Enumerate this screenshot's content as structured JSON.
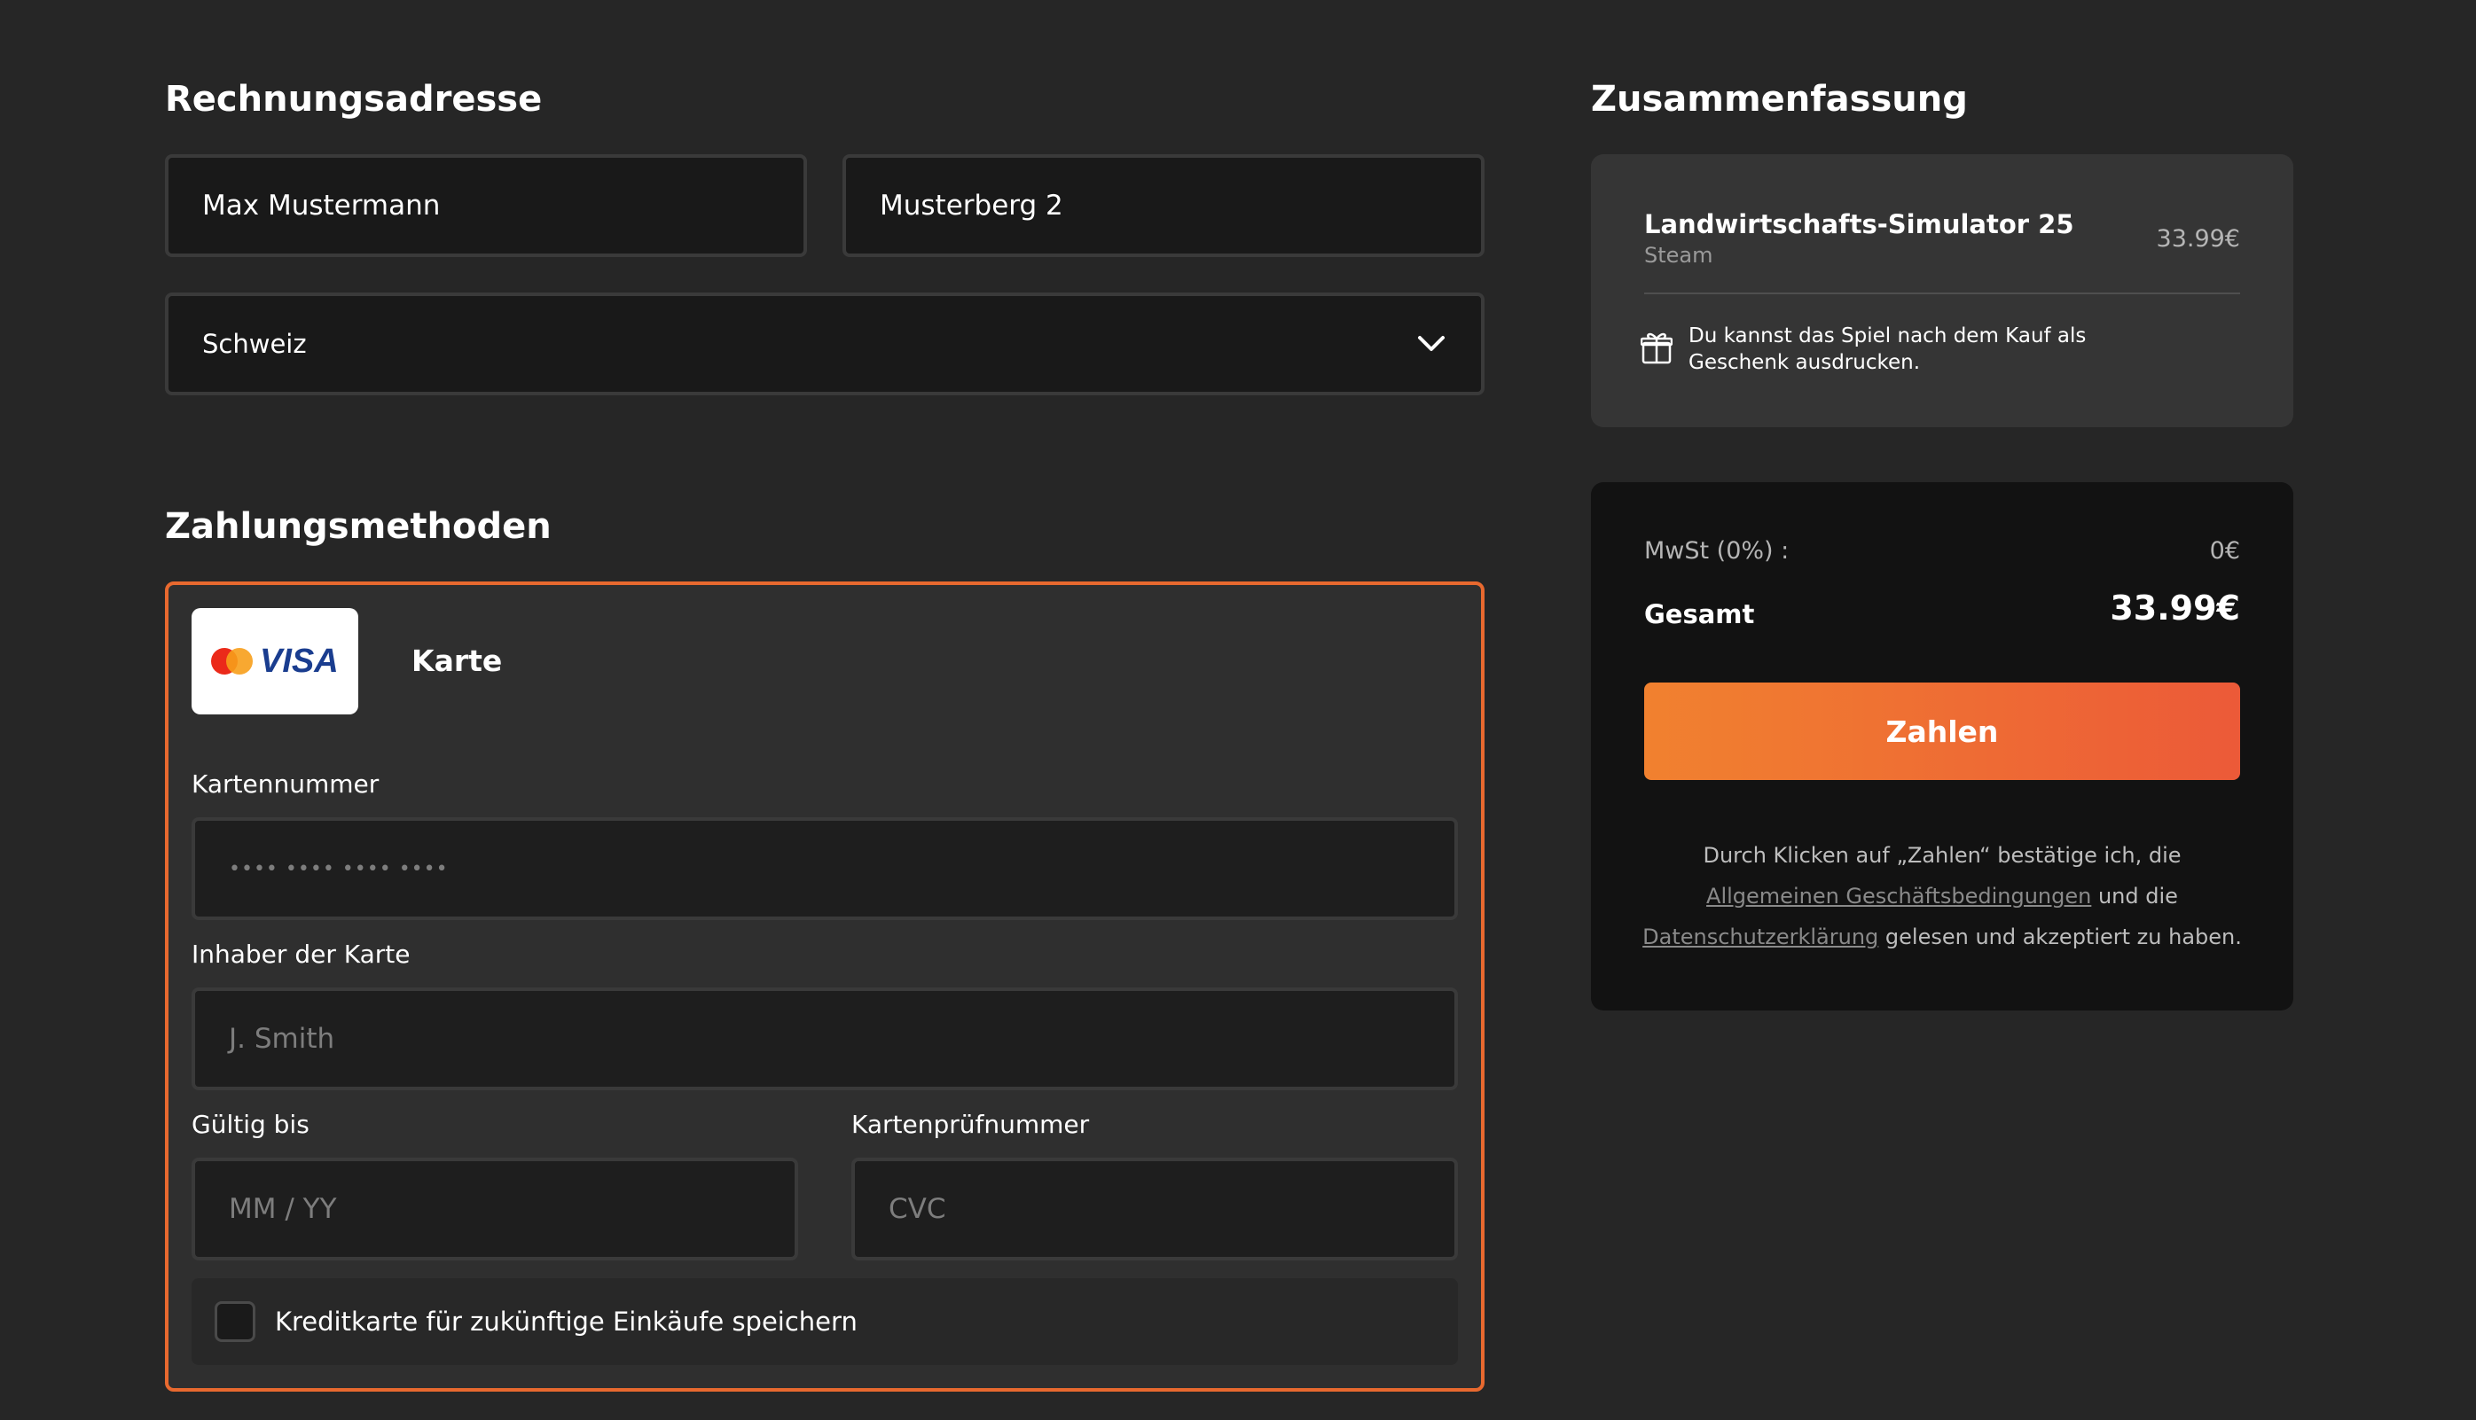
{
  "billing": {
    "title": "Rechnungsadresse",
    "name_value": "Max Mustermann",
    "street_value": "Musterberg 2",
    "country_value": "Schweiz"
  },
  "payment": {
    "title": "Zahlungsmethoden",
    "method_label": "Karte",
    "card_brand": "VISA",
    "card_number_label": "Kartennummer",
    "card_number_placeholder": "•••• •••• •••• ••••",
    "holder_label": "Inhaber der Karte",
    "holder_placeholder": "J. Smith",
    "expiry_label": "Gültig bis",
    "expiry_placeholder": "MM / YY",
    "cvc_label": "Kartenprüfnummer",
    "cvc_placeholder": "CVC",
    "save_label": "Kreditkarte für zukünftige Einkäufe speichern"
  },
  "summary": {
    "title": "Zusammenfassung",
    "product_name": "Landwirtschafts-Simulator 25",
    "platform": "Steam",
    "price": "33.99€",
    "gift_note": "Du kannst das Spiel nach dem Kauf als Geschenk ausdrucken."
  },
  "totals": {
    "vat_label": "MwSt (0%) :",
    "vat_value": "0€",
    "total_label": "Gesamt",
    "total_value": "33.99€",
    "pay_button": "Zahlen",
    "legal_prefix": "Durch Klicken auf „Zahlen“ bestätige ich, die ",
    "legal_terms_link": "Allgemeinen Geschäftsbedingungen",
    "legal_middle": " und die ",
    "legal_privacy_link": "Datenschutzerklärung",
    "legal_suffix": " gelesen und akzeptiert zu haben."
  },
  "colors": {
    "accent": "#e8692f",
    "background": "#262626",
    "field_bg": "#191919"
  }
}
